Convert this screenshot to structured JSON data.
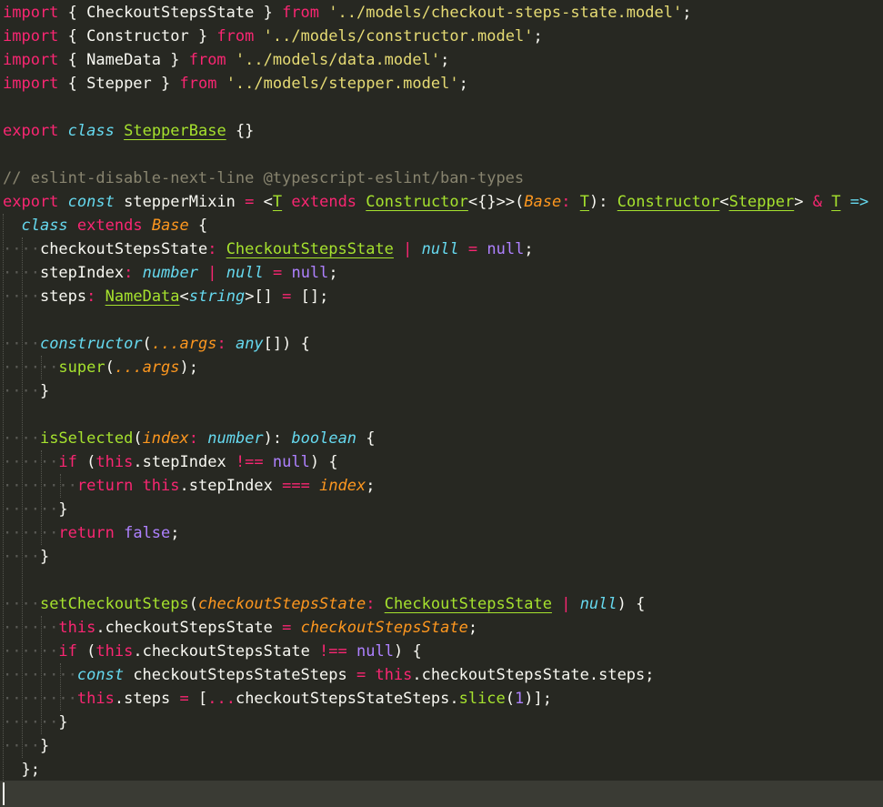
{
  "editor": {
    "language": "typescript",
    "theme_colors": {
      "background": "#272822",
      "keyword": "#f92672",
      "string": "#e6db74",
      "storage": "#66d9ef",
      "entity": "#a6e22e",
      "parameter": "#fd971f",
      "constant": "#ae81ff",
      "comment": "#88846f",
      "text": "#f8f8f2"
    },
    "lines": [
      [
        [
          "kw",
          "import"
        ],
        [
          "p",
          " { CheckoutStepsState } "
        ],
        [
          "kw",
          "from"
        ],
        [
          "p",
          " "
        ],
        [
          "str",
          "'../models/checkout-steps-state.model'"
        ],
        [
          "p",
          ";"
        ]
      ],
      [
        [
          "kw",
          "import"
        ],
        [
          "p",
          " { Constructor } "
        ],
        [
          "kw",
          "from"
        ],
        [
          "p",
          " "
        ],
        [
          "str",
          "'../models/constructor.model'"
        ],
        [
          "p",
          ";"
        ]
      ],
      [
        [
          "kw",
          "import"
        ],
        [
          "p",
          " { NameData } "
        ],
        [
          "kw",
          "from"
        ],
        [
          "p",
          " "
        ],
        [
          "str",
          "'../models/data.model'"
        ],
        [
          "p",
          ";"
        ]
      ],
      [
        [
          "kw",
          "import"
        ],
        [
          "p",
          " { Stepper } "
        ],
        [
          "kw",
          "from"
        ],
        [
          "p",
          " "
        ],
        [
          "str",
          "'../models/stepper.model'"
        ],
        [
          "p",
          ";"
        ]
      ],
      [],
      [
        [
          "kw",
          "export"
        ],
        [
          "p",
          " "
        ],
        [
          "sto",
          "class"
        ],
        [
          "p",
          " "
        ],
        [
          "cls",
          "StepperBase"
        ],
        [
          "p",
          " {}"
        ]
      ],
      [],
      [
        [
          "com",
          "// eslint-disable-next-line @typescript-eslint/ban-types"
        ]
      ],
      [
        [
          "kw",
          "export"
        ],
        [
          "p",
          " "
        ],
        [
          "sto",
          "const"
        ],
        [
          "p",
          " stepperMixin "
        ],
        [
          "kw",
          "="
        ],
        [
          "p",
          " <"
        ],
        [
          "cls",
          "T"
        ],
        [
          "p",
          " "
        ],
        [
          "kw",
          "extends"
        ],
        [
          "p",
          " "
        ],
        [
          "cls",
          "Constructor"
        ],
        [
          "p",
          "<{}>>("
        ],
        [
          "par",
          "Base"
        ],
        [
          "kw",
          ":"
        ],
        [
          "p",
          " "
        ],
        [
          "cls",
          "T"
        ],
        [
          "p",
          "): "
        ],
        [
          "cls",
          "Constructor"
        ],
        [
          "p",
          "<"
        ],
        [
          "cls",
          "Stepper"
        ],
        [
          "p",
          "> "
        ],
        [
          "kw",
          "&"
        ],
        [
          "p",
          " "
        ],
        [
          "cls",
          "T"
        ],
        [
          "p",
          " "
        ],
        [
          "sto",
          "=>"
        ]
      ],
      [
        [
          "ws",
          "  "
        ],
        [
          "sto",
          "class"
        ],
        [
          "p",
          " "
        ],
        [
          "kw",
          "extends"
        ],
        [
          "p",
          " "
        ],
        [
          "par",
          "Base"
        ],
        [
          "p",
          " {"
        ]
      ],
      [
        [
          "ws",
          "····"
        ],
        [
          "p",
          "checkoutStepsState"
        ],
        [
          "kw",
          ":"
        ],
        [
          "p",
          " "
        ],
        [
          "cls",
          "CheckoutStepsState"
        ],
        [
          "p",
          " "
        ],
        [
          "kw",
          "|"
        ],
        [
          "p",
          " "
        ],
        [
          "sto",
          "null"
        ],
        [
          "p",
          " "
        ],
        [
          "kw",
          "="
        ],
        [
          "p",
          " "
        ],
        [
          "con",
          "null"
        ],
        [
          "p",
          ";"
        ]
      ],
      [
        [
          "ws",
          "····"
        ],
        [
          "p",
          "stepIndex"
        ],
        [
          "kw",
          ":"
        ],
        [
          "p",
          " "
        ],
        [
          "sto",
          "number"
        ],
        [
          "p",
          " "
        ],
        [
          "kw",
          "|"
        ],
        [
          "p",
          " "
        ],
        [
          "sto",
          "null"
        ],
        [
          "p",
          " "
        ],
        [
          "kw",
          "="
        ],
        [
          "p",
          " "
        ],
        [
          "con",
          "null"
        ],
        [
          "p",
          ";"
        ]
      ],
      [
        [
          "ws",
          "····"
        ],
        [
          "p",
          "steps"
        ],
        [
          "kw",
          ":"
        ],
        [
          "p",
          " "
        ],
        [
          "cls",
          "NameData"
        ],
        [
          "p",
          "<"
        ],
        [
          "sto",
          "string"
        ],
        [
          "p",
          ">[] "
        ],
        [
          "kw",
          "="
        ],
        [
          "p",
          " [];"
        ]
      ],
      [],
      [
        [
          "ws",
          "····"
        ],
        [
          "func",
          "constructor"
        ],
        [
          "p",
          "("
        ],
        [
          "par",
          "...args"
        ],
        [
          "kw",
          ":"
        ],
        [
          "p",
          " "
        ],
        [
          "sto",
          "any"
        ],
        [
          "p",
          "[]) {"
        ]
      ],
      [
        [
          "ws",
          "······"
        ],
        [
          "fn",
          "super"
        ],
        [
          "p",
          "("
        ],
        [
          "par",
          "...args"
        ],
        [
          "p",
          ");"
        ]
      ],
      [
        [
          "ws",
          "····"
        ],
        [
          "p",
          "}"
        ]
      ],
      [],
      [
        [
          "ws",
          "····"
        ],
        [
          "fn",
          "isSelected"
        ],
        [
          "p",
          "("
        ],
        [
          "par",
          "index"
        ],
        [
          "kw",
          ":"
        ],
        [
          "p",
          " "
        ],
        [
          "sto",
          "number"
        ],
        [
          "p",
          "): "
        ],
        [
          "sto",
          "boolean"
        ],
        [
          "p",
          " {"
        ]
      ],
      [
        [
          "ws",
          "······"
        ],
        [
          "kw",
          "if"
        ],
        [
          "p",
          " ("
        ],
        [
          "kw",
          "this"
        ],
        [
          "p",
          ".stepIndex "
        ],
        [
          "kw",
          "!=="
        ],
        [
          "p",
          " "
        ],
        [
          "con",
          "null"
        ],
        [
          "p",
          ") {"
        ]
      ],
      [
        [
          "ws",
          "········"
        ],
        [
          "kw",
          "return"
        ],
        [
          "p",
          " "
        ],
        [
          "kw",
          "this"
        ],
        [
          "p",
          ".stepIndex "
        ],
        [
          "kw",
          "==="
        ],
        [
          "p",
          " "
        ],
        [
          "par",
          "index"
        ],
        [
          "p",
          ";"
        ]
      ],
      [
        [
          "ws",
          "······"
        ],
        [
          "p",
          "}"
        ]
      ],
      [
        [
          "ws",
          "······"
        ],
        [
          "kw",
          "return"
        ],
        [
          "p",
          " "
        ],
        [
          "con",
          "false"
        ],
        [
          "p",
          ";"
        ]
      ],
      [
        [
          "ws",
          "····"
        ],
        [
          "p",
          "}"
        ]
      ],
      [],
      [
        [
          "ws",
          "····"
        ],
        [
          "fn",
          "setCheckoutSteps"
        ],
        [
          "p",
          "("
        ],
        [
          "par",
          "checkoutStepsState"
        ],
        [
          "kw",
          ":"
        ],
        [
          "p",
          " "
        ],
        [
          "cls",
          "CheckoutStepsState"
        ],
        [
          "p",
          " "
        ],
        [
          "kw",
          "|"
        ],
        [
          "p",
          " "
        ],
        [
          "sto",
          "null"
        ],
        [
          "p",
          ") {"
        ]
      ],
      [
        [
          "ws",
          "······"
        ],
        [
          "kw",
          "this"
        ],
        [
          "p",
          ".checkoutStepsState "
        ],
        [
          "kw",
          "="
        ],
        [
          "p",
          " "
        ],
        [
          "par",
          "checkoutStepsState"
        ],
        [
          "p",
          ";"
        ]
      ],
      [
        [
          "ws",
          "······"
        ],
        [
          "kw",
          "if"
        ],
        [
          "p",
          " ("
        ],
        [
          "kw",
          "this"
        ],
        [
          "p",
          ".checkoutStepsState "
        ],
        [
          "kw",
          "!=="
        ],
        [
          "p",
          " "
        ],
        [
          "con",
          "null"
        ],
        [
          "p",
          ") {"
        ]
      ],
      [
        [
          "ws",
          "········"
        ],
        [
          "sto",
          "const"
        ],
        [
          "p",
          " checkoutStepsStateSteps "
        ],
        [
          "kw",
          "="
        ],
        [
          "p",
          " "
        ],
        [
          "kw",
          "this"
        ],
        [
          "p",
          ".checkoutStepsState.steps;"
        ]
      ],
      [
        [
          "ws",
          "········"
        ],
        [
          "kw",
          "this"
        ],
        [
          "p",
          ".steps "
        ],
        [
          "kw",
          "="
        ],
        [
          "p",
          " ["
        ],
        [
          "kw",
          "..."
        ],
        [
          "p",
          "checkoutStepsStateSteps."
        ],
        [
          "fn",
          "slice"
        ],
        [
          "p",
          "("
        ],
        [
          "con",
          "1"
        ],
        [
          "p",
          ")];"
        ]
      ],
      [
        [
          "ws",
          "······"
        ],
        [
          "p",
          "}"
        ]
      ],
      [
        [
          "ws",
          "····"
        ],
        [
          "p",
          "}"
        ]
      ],
      [
        [
          "ws",
          "  "
        ],
        [
          "p",
          "};"
        ]
      ]
    ]
  }
}
